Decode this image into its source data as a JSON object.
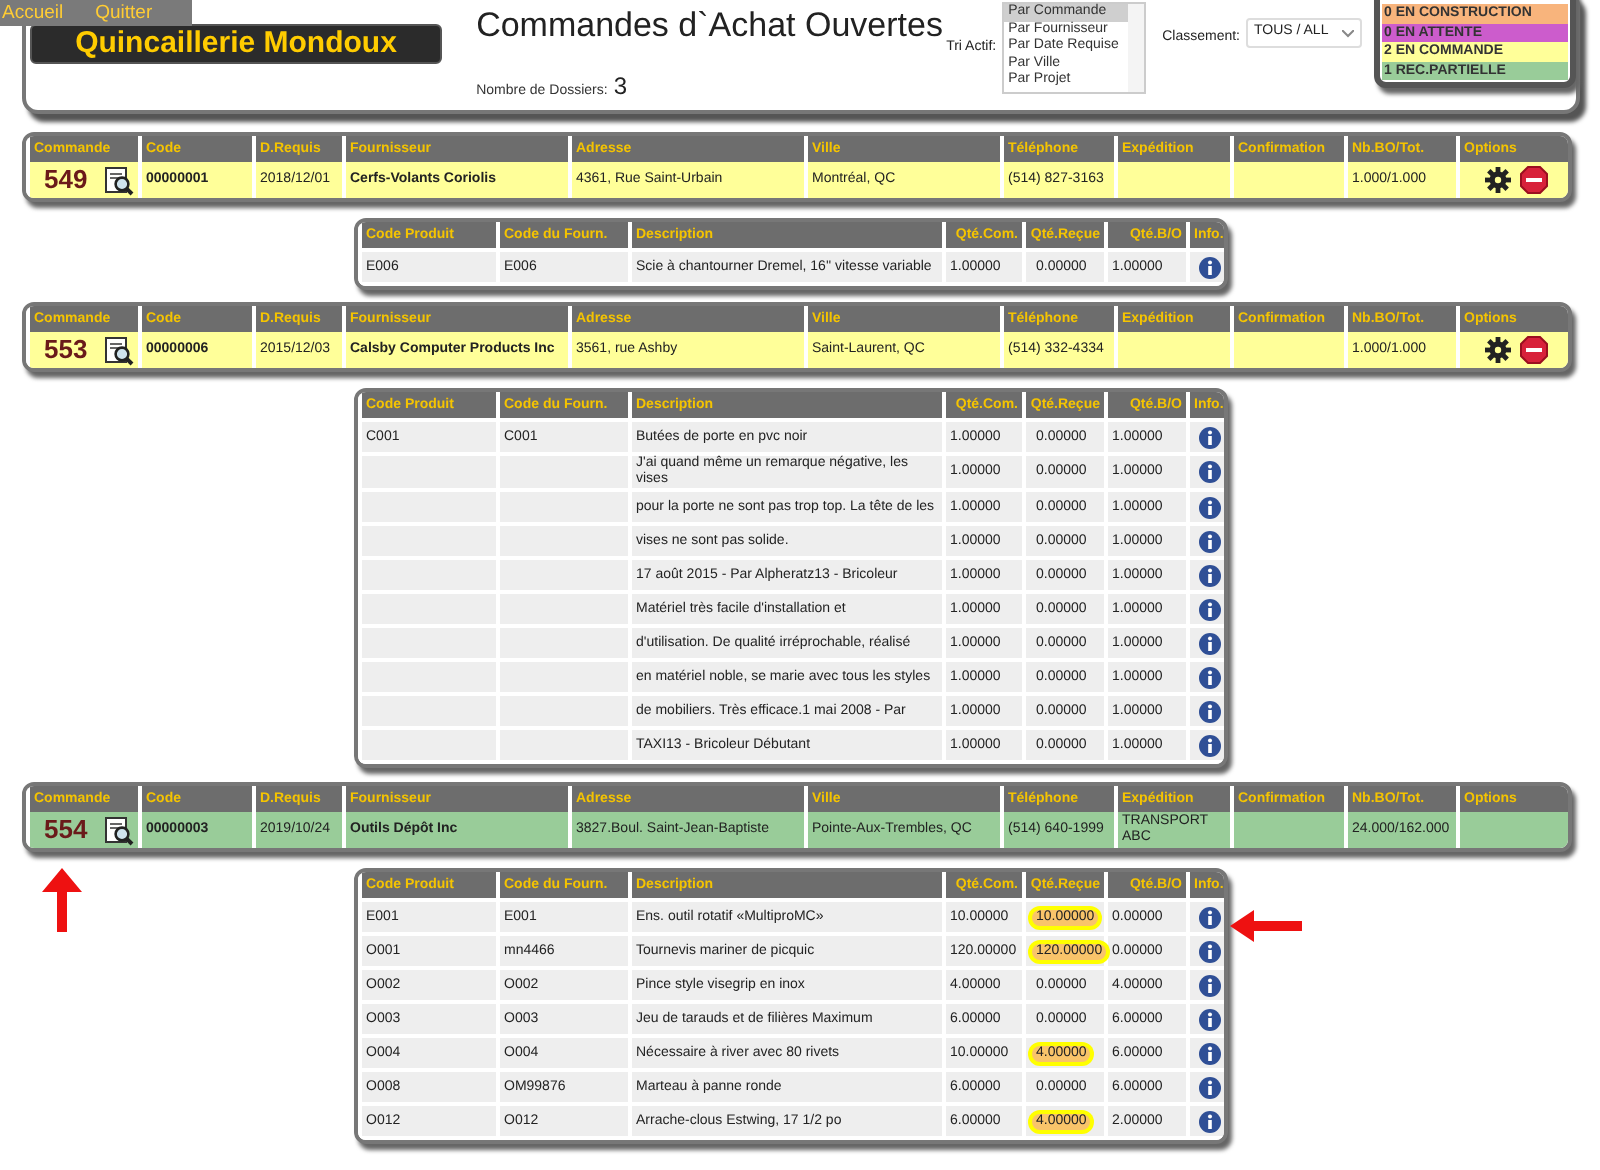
{
  "menu": [
    {
      "label": "Accueil"
    },
    {
      "label": "Quitter"
    }
  ],
  "logo": {
    "text": "Quincaillerie Mondoux"
  },
  "title": "Commandes d`Achat Ouvertes",
  "dossiers": {
    "label": "Nombre de Dossiers:",
    "count": "3"
  },
  "sort": {
    "label": "Tri Actif:",
    "options": [
      {
        "label": "Par Commande",
        "selected": true
      },
      {
        "label": "Par Fournisseur",
        "selected": false
      },
      {
        "label": "Par Date Requise",
        "selected": false
      },
      {
        "label": "Par Ville",
        "selected": false
      },
      {
        "label": "Par Projet",
        "selected": false
      }
    ]
  },
  "filter": {
    "label": "Classement:",
    "value": "TOUS / ALL"
  },
  "legend": [
    {
      "label": "0 EN CONSTRUCTION",
      "color": "#f8b47c"
    },
    {
      "label": "0 EN ATTENTE",
      "color": "#cc5ccc"
    },
    {
      "label": "2 EN COMMANDE",
      "color": "#ffff99"
    },
    {
      "label": "1 REC.PARTIELLE",
      "color": "#99cc99"
    }
  ],
  "orders": [
    {
      "columns": [
        "Commande",
        "Code",
        "D.Requis",
        "Fournisseur",
        "Adresse",
        "Ville",
        "Téléphone",
        "Expédition",
        "Confirmation",
        "Nb.BO/Tot.",
        "Options"
      ],
      "number": "549",
      "code": "00000001",
      "date": "2018/12/01",
      "supplier": "Cerfs-Volants Coriolis",
      "address": "4361, Rue Saint-Urbain",
      "city": "Montréal, QC",
      "phone": "(514) 827-3163",
      "bo_total": "1.000/1.000",
      "color": "#ffff99",
      "options": [
        {
          "kind": "gear"
        },
        {
          "kind": "stop"
        }
      ],
      "detail_columns": [
        "Code Produit",
        "Code du Fourn.",
        "Description",
        "Qté.Com.",
        "Qté.Reçue",
        "Qté.B/O",
        "Info."
      ],
      "lines": [
        {
          "product": "E006",
          "supplier_code": "E006",
          "description": "Scie à chantourner Dremel, 16'' vitesse variable",
          "ordered": "1.00000",
          "received": "0.00000",
          "backorder": "1.00000",
          "highlighted": false
        }
      ]
    },
    {
      "columns": [
        "Commande",
        "Code",
        "D.Requis",
        "Fournisseur",
        "Adresse",
        "Ville",
        "Téléphone",
        "Expédition",
        "Confirmation",
        "Nb.BO/Tot.",
        "Options"
      ],
      "number": "553",
      "code": "00000006",
      "date": "2015/12/03",
      "supplier": "Calsby Computer Products Inc",
      "address": "3561, rue Ashby",
      "city": "Saint-Laurent, QC",
      "phone": "(514) 332-4334",
      "bo_total": "1.000/1.000",
      "color": "#ffff99",
      "options": [
        {
          "kind": "gear"
        },
        {
          "kind": "stop"
        }
      ],
      "detail_columns": [
        "Code Produit",
        "Code du Fourn.",
        "Description",
        "Qté.Com.",
        "Qté.Reçue",
        "Qté.B/O",
        "Info."
      ],
      "lines": [
        {
          "product": "C001",
          "supplier_code": "C001",
          "description": "Butées de porte en pvc noir",
          "ordered": "1.00000",
          "received": "0.00000",
          "backorder": "1.00000",
          "highlighted": false
        },
        {
          "description": "J'ai quand même un remarque négative, les vises",
          "ordered": "1.00000",
          "received": "0.00000",
          "backorder": "1.00000",
          "highlighted": false
        },
        {
          "description": "pour la porte ne sont pas trop top. La tête de les",
          "ordered": "1.00000",
          "received": "0.00000",
          "backorder": "1.00000",
          "highlighted": false
        },
        {
          "description": "vises ne sont pas solide.",
          "ordered": "1.00000",
          "received": "0.00000",
          "backorder": "1.00000",
          "highlighted": false
        },
        {
          "description": "17 août 2015 - Par Alpheratz13 - Bricoleur",
          "ordered": "1.00000",
          "received": "0.00000",
          "backorder": "1.00000",
          "highlighted": false
        },
        {
          "description": "Matériel très facile d'installation et",
          "ordered": "1.00000",
          "received": "0.00000",
          "backorder": "1.00000",
          "highlighted": false
        },
        {
          "description": "d'utilisation. De qualité irréprochable, réalisé",
          "ordered": "1.00000",
          "received": "0.00000",
          "backorder": "1.00000",
          "highlighted": false
        },
        {
          "description": "en matériel noble, se marie avec tous les styles",
          "ordered": "1.00000",
          "received": "0.00000",
          "backorder": "1.00000",
          "highlighted": false
        },
        {
          "description": "de mobiliers. Très efficace.1 mai 2008 - Par",
          "ordered": "1.00000",
          "received": "0.00000",
          "backorder": "1.00000",
          "highlighted": false
        },
        {
          "description": "TAXI13 - Bricoleur Débutant",
          "ordered": "1.00000",
          "received": "0.00000",
          "backorder": "1.00000",
          "highlighted": false
        }
      ]
    },
    {
      "columns": [
        "Commande",
        "Code",
        "D.Requis",
        "Fournisseur",
        "Adresse",
        "Ville",
        "Téléphone",
        "Expédition",
        "Confirmation",
        "Nb.BO/Tot.",
        "Options"
      ],
      "number": "554",
      "code": "00000003",
      "date": "2019/10/24",
      "supplier": "Outils Dépôt Inc",
      "address": "3827.Boul. Saint-Jean-Baptiste",
      "city": "Pointe-Aux-Trembles, QC",
      "phone": "(514) 640-1999",
      "shipping": "TRANSPORT ABC",
      "bo_total": "24.000/162.000",
      "color": "#99cc99",
      "detail_columns": [
        "Code Produit",
        "Code du Fourn.",
        "Description",
        "Qté.Com.",
        "Qté.Reçue",
        "Qté.B/O",
        "Info."
      ],
      "lines": [
        {
          "product": "E001",
          "supplier_code": "E001",
          "description": "Ens. outil rotatif «MultiproMC»",
          "ordered": "10.00000",
          "received": "10.00000",
          "backorder": "0.00000",
          "highlighted": true
        },
        {
          "product": "O001",
          "supplier_code": "mn4466",
          "description": "Tournevis mariner de picquic",
          "ordered": "120.00000",
          "received": "120.00000",
          "backorder": "0.00000",
          "highlighted": true
        },
        {
          "product": "O002",
          "supplier_code": "O002",
          "description": "Pince style visegrip en inox",
          "ordered": "4.00000",
          "received": "0.00000",
          "backorder": "4.00000",
          "highlighted": false
        },
        {
          "product": "O003",
          "supplier_code": "O003",
          "description": "Jeu de tarauds et de filières Maximum",
          "ordered": "6.00000",
          "received": "0.00000",
          "backorder": "6.00000",
          "highlighted": false
        },
        {
          "product": "O004",
          "supplier_code": "O004",
          "description": "Nécessaire à river avec 80 rivets",
          "ordered": "10.00000",
          "received": "4.00000",
          "backorder": "6.00000",
          "highlighted": true
        },
        {
          "product": "O008",
          "supplier_code": "OM99876",
          "description": "Marteau à panne ronde",
          "ordered": "6.00000",
          "received": "0.00000",
          "backorder": "6.00000",
          "highlighted": false
        },
        {
          "product": "O012",
          "supplier_code": "O012",
          "description": "Arrache-clous Estwing, 17 1/2 po",
          "ordered": "6.00000",
          "received": "4.00000",
          "backorder": "2.00000",
          "highlighted": true
        }
      ]
    }
  ]
}
